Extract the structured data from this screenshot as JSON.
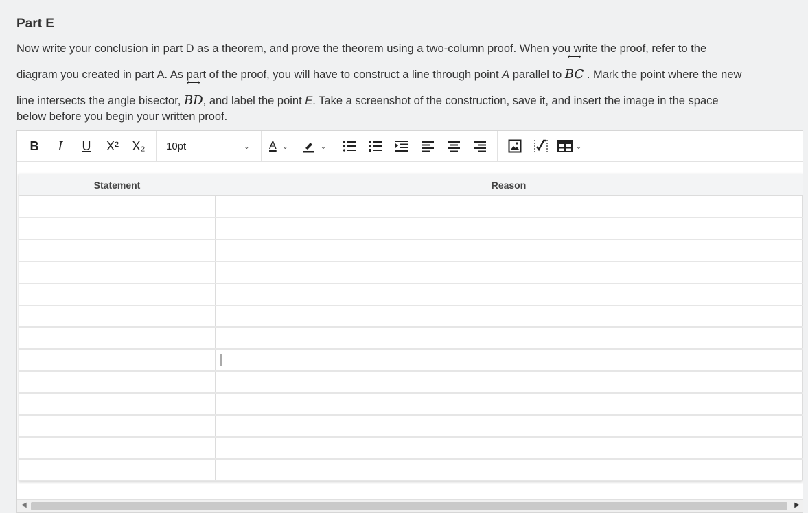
{
  "part": {
    "title": "Part E"
  },
  "instructions": {
    "line1": "Now write your conclusion in part D as a theorem, and prove the theorem using a two-column proof. When you write the proof, refer to the",
    "line2_pre": "diagram you created in part A. As part of the proof, you will have to construct a line through point ",
    "line2_point": "A",
    "line2_mid": " parallel to ",
    "line2_math": "BC",
    "line2_post": " . Mark the point where the new",
    "line3_pre": "line intersects the angle bisector, ",
    "line3_math": "BD",
    "line3_mid": ", and label the point ",
    "line3_point": "E",
    "line3_post": ". Take a screenshot of the construction, save it, and insert the image in the space",
    "line4": "below before you begin your written proof."
  },
  "toolbar": {
    "bold": "B",
    "italic": "I",
    "underline": "U",
    "superscript": "X²",
    "subscript": "X₂",
    "font_size": "10pt",
    "font_color": "A"
  },
  "table": {
    "headers": [
      "Statement",
      "Reason"
    ],
    "row_count": 13
  },
  "colors": {
    "background": "#f0f1f2",
    "editor": "#ffffff",
    "border": "#d6d6d6"
  }
}
